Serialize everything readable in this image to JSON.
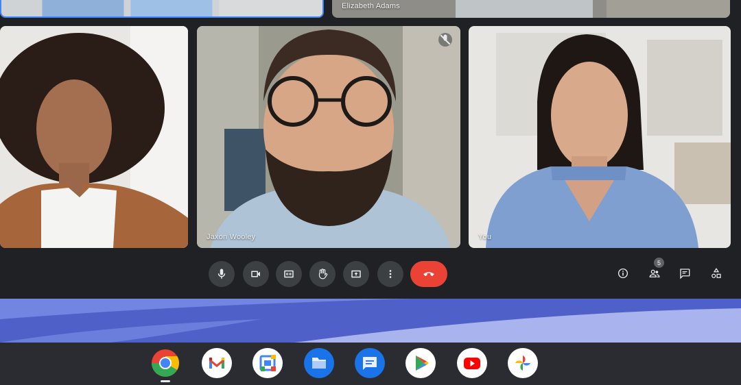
{
  "meet": {
    "participants": [
      {
        "name": ""
      },
      {
        "name": "Elizabeth Adams"
      },
      {
        "name": ""
      },
      {
        "name": "Jaxon Wooley"
      },
      {
        "name": "You"
      }
    ],
    "participant_count": "5",
    "controls": [
      "microphone-icon",
      "camera-icon",
      "captions-icon",
      "raise-hand-icon",
      "present-icon",
      "more-options-icon",
      "end-call-icon"
    ],
    "right_icons": [
      "info-icon",
      "people-icon",
      "chat-icon",
      "activities-icon"
    ]
  },
  "shelf": {
    "apps": [
      "Chrome",
      "Gmail",
      "Calendar",
      "Files",
      "Messages",
      "Play Store",
      "YouTube",
      "Photos"
    ]
  },
  "colors": {
    "background": "#202124",
    "button": "#3c4043",
    "end_call": "#ea4335",
    "active_tile_border": "#4285f4"
  }
}
